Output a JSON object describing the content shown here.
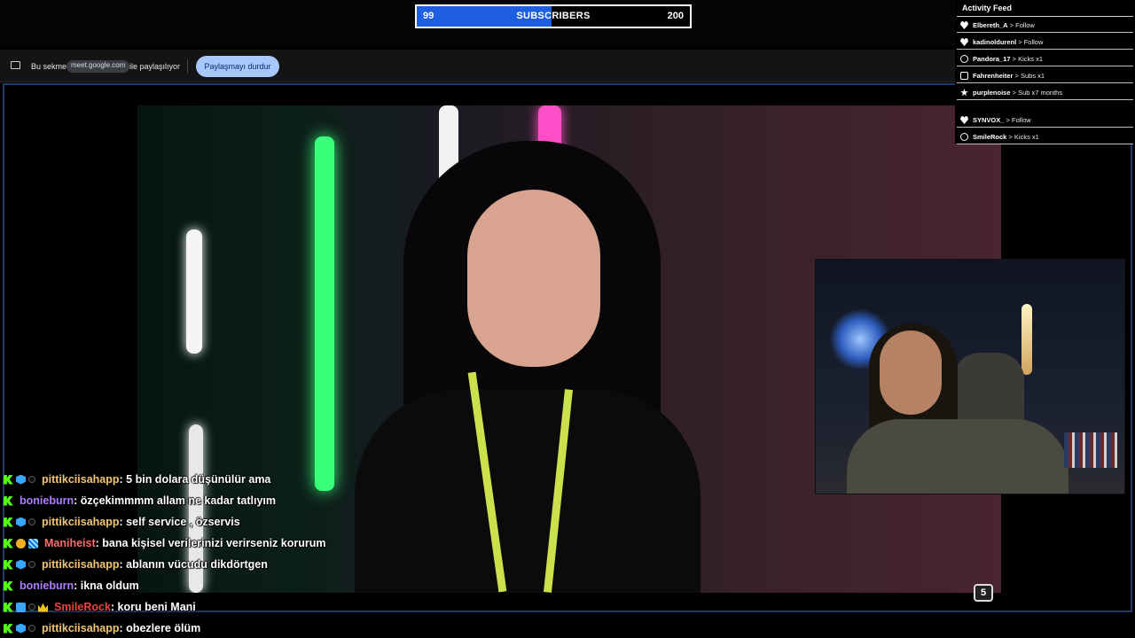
{
  "subscriber_goal": {
    "current": "99",
    "label": "SUBSCRIBERS",
    "target": "200",
    "progress": 0.495,
    "fill_color": "#1d5fe0"
  },
  "share_bar": {
    "text_before": "Bu sekme",
    "site": "meet.google.com",
    "text_after": "ile paylaşılıyor",
    "stop_button": "Paylaşmayı durdur"
  },
  "activity_feed": {
    "title": "Activity Feed",
    "items": [
      {
        "user": "Elbereth_A",
        "action": " > Follow",
        "icon": "heart-icon"
      },
      {
        "user": "kadinoldurenl",
        "action": " > Follow",
        "icon": "heart-icon"
      },
      {
        "user": "Pandora_17",
        "action": " > Kicks x1",
        "icon": "kick-icon"
      },
      {
        "user": "Fahrenheiter",
        "action": " > Subs x1",
        "icon": "sub-icon"
      },
      {
        "user": "purplenoise",
        "action": " > Sub x7 months",
        "icon": "star-icon"
      },
      {
        "user": "SYNVOX_",
        "action": " > Follow",
        "icon": "heart-icon"
      },
      {
        "user": "SmileRock",
        "action": " > Kicks x1",
        "icon": "kick-icon"
      }
    ]
  },
  "chat": {
    "messages": [
      {
        "user": "pittikciisahapp",
        "color": "#f0c674",
        "badges": [
          "kick",
          "cube",
          "dot"
        ],
        "text": ": 5 bin dolara düşünülür ama"
      },
      {
        "user": "bonieburn",
        "color": "#b07cff",
        "badges": [
          "kick"
        ],
        "text": ": özçekimmmm allam ne kadar tatlıyım"
      },
      {
        "user": "pittikciisahapp",
        "color": "#f0c674",
        "badges": [
          "kick",
          "cube",
          "dot"
        ],
        "text": ": self service , özservis"
      },
      {
        "user": "Maniheist",
        "color": "#ff6b6b",
        "badges": [
          "kick",
          "gold",
          "grid"
        ],
        "text": ": bana kişisel verilerinizi verirseniz korurum"
      },
      {
        "user": "pittikciisahapp",
        "color": "#f0c674",
        "badges": [
          "kick",
          "cube",
          "dot"
        ],
        "text": ": ablanın vücudu dikdörtgen"
      },
      {
        "user": "bonieburn",
        "color": "#b07cff",
        "badges": [
          "kick"
        ],
        "text": ": ikna oldum"
      },
      {
        "user": "SmileRock",
        "color": "#e8453c",
        "badges": [
          "kick",
          "prime",
          "dot",
          "crown"
        ],
        "text": ": koru beni Mani"
      },
      {
        "user": "pittikciisahapp",
        "color": "#f0c674",
        "badges": [
          "kick",
          "cube",
          "dot"
        ],
        "text": ": obezlere ölüm"
      }
    ]
  }
}
